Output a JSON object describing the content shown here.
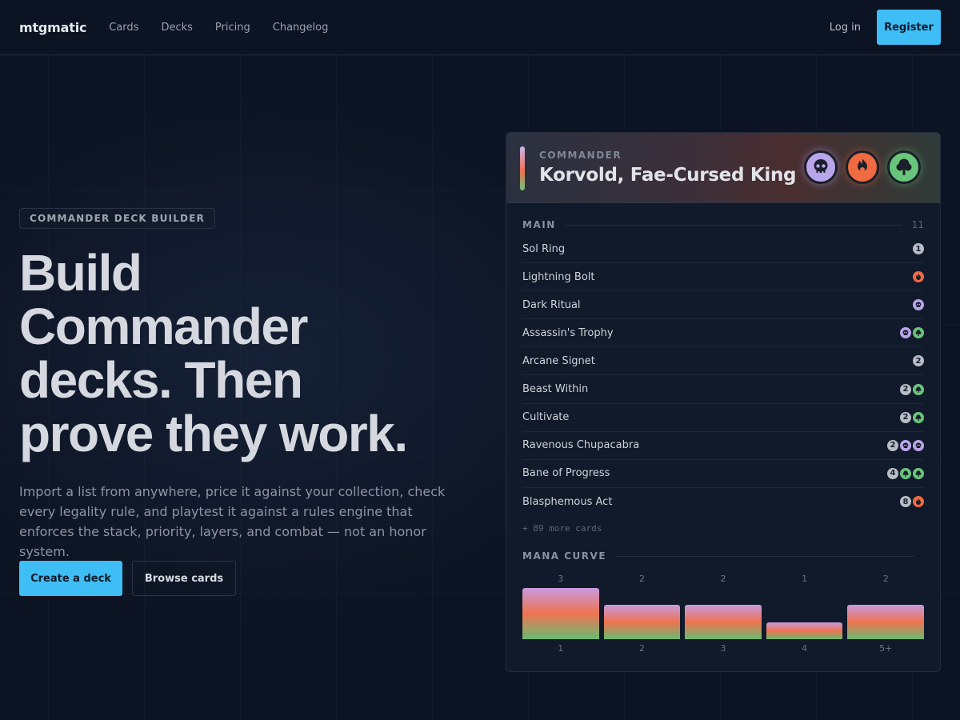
{
  "nav": {
    "brand": "mtgmatic",
    "links": [
      "Cards",
      "Decks",
      "Pricing",
      "Changelog"
    ],
    "login": "Log in",
    "register": "Register"
  },
  "hero": {
    "pill": "COMMANDER DECK BUILDER",
    "headline_lines": [
      "Build",
      "Commander",
      "decks. Then",
      "prove they work."
    ],
    "subtitle": "Import a list from anywhere, price it against your collection, check every legality rule, and playtest it against a rules engine that enforces the stack, priority, layers, and combat — not an honor system.",
    "cta_primary": "Create a deck",
    "cta_secondary": "Browse cards"
  },
  "commander": {
    "label": "COMMANDER",
    "name": "Korvold, Fae-Cursed King",
    "colors": [
      {
        "icon": "black-mana-skull-icon",
        "color": "#b9a5ea"
      },
      {
        "icon": "red-mana-fire-icon",
        "color": "#f06a42"
      },
      {
        "icon": "green-mana-tree-icon",
        "color": "#68c67a"
      }
    ]
  },
  "main": {
    "title": "MAIN",
    "count": "11",
    "cards": [
      {
        "name": "Sol Ring",
        "cost": [
          {
            "t": "c",
            "v": "1"
          }
        ]
      },
      {
        "name": "Lightning Bolt",
        "cost": [
          {
            "t": "r",
            "v": ""
          }
        ]
      },
      {
        "name": "Dark Ritual",
        "cost": [
          {
            "t": "b",
            "v": ""
          }
        ]
      },
      {
        "name": "Assassin's Trophy",
        "cost": [
          {
            "t": "b",
            "v": ""
          },
          {
            "t": "g",
            "v": ""
          }
        ]
      },
      {
        "name": "Arcane Signet",
        "cost": [
          {
            "t": "c",
            "v": "2"
          }
        ]
      },
      {
        "name": "Beast Within",
        "cost": [
          {
            "t": "c",
            "v": "2"
          },
          {
            "t": "g",
            "v": ""
          }
        ]
      },
      {
        "name": "Cultivate",
        "cost": [
          {
            "t": "c",
            "v": "2"
          },
          {
            "t": "g",
            "v": ""
          }
        ]
      },
      {
        "name": "Ravenous Chupacabra",
        "cost": [
          {
            "t": "c",
            "v": "2"
          },
          {
            "t": "b",
            "v": ""
          },
          {
            "t": "b",
            "v": ""
          }
        ]
      },
      {
        "name": "Bane of Progress",
        "cost": [
          {
            "t": "c",
            "v": "4"
          },
          {
            "t": "g",
            "v": ""
          },
          {
            "t": "g",
            "v": ""
          }
        ]
      },
      {
        "name": "Blasphemous Act",
        "cost": [
          {
            "t": "c",
            "v": "8"
          },
          {
            "t": "r",
            "v": ""
          }
        ]
      }
    ],
    "more": "+ 89 more cards"
  },
  "curve": {
    "title": "MANA CURVE",
    "chart_data": {
      "type": "bar",
      "categories": [
        "1",
        "2",
        "3",
        "4",
        "5+"
      ],
      "values": [
        3,
        2,
        2,
        1,
        2
      ],
      "ylim": [
        0,
        3
      ]
    }
  }
}
